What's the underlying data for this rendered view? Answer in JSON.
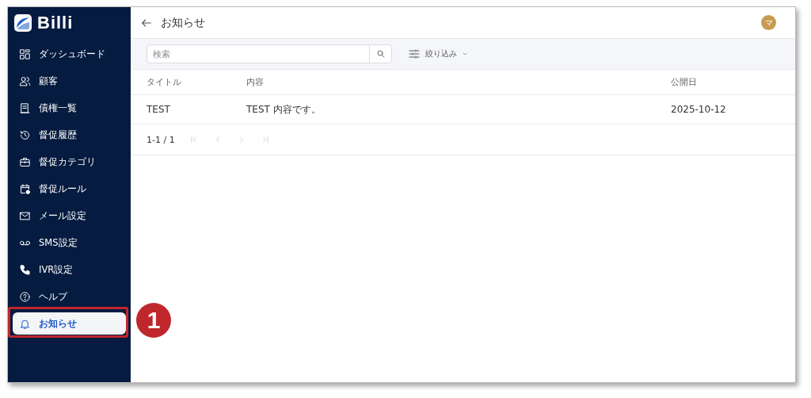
{
  "logo": {
    "text": "Billi"
  },
  "sidebar": {
    "items": [
      {
        "label": "ダッシュボード",
        "selected": false
      },
      {
        "label": "顧客",
        "selected": false
      },
      {
        "label": "債権一覧",
        "selected": false
      },
      {
        "label": "督促履歴",
        "selected": false
      },
      {
        "label": "督促カテゴリ",
        "selected": false
      },
      {
        "label": "督促ルール",
        "selected": false
      },
      {
        "label": "メール設定",
        "selected": false
      },
      {
        "label": "SMS設定",
        "selected": false
      },
      {
        "label": "IVR設定",
        "selected": false
      },
      {
        "label": "ヘルプ",
        "selected": false
      },
      {
        "label": "お知らせ",
        "selected": true
      }
    ]
  },
  "callout": {
    "number": "1"
  },
  "header": {
    "title": "お知らせ",
    "avatar": "マ"
  },
  "toolbar": {
    "search": {
      "placeholder": "検索"
    },
    "filter": "絞り込み"
  },
  "table": {
    "columns": [
      "タイトル",
      "内容",
      "公開日"
    ],
    "rows": [
      [
        "TEST",
        "TEST 内容です。",
        "2025-10-12"
      ]
    ]
  },
  "pagination": {
    "range": "1-1 / 1"
  }
}
